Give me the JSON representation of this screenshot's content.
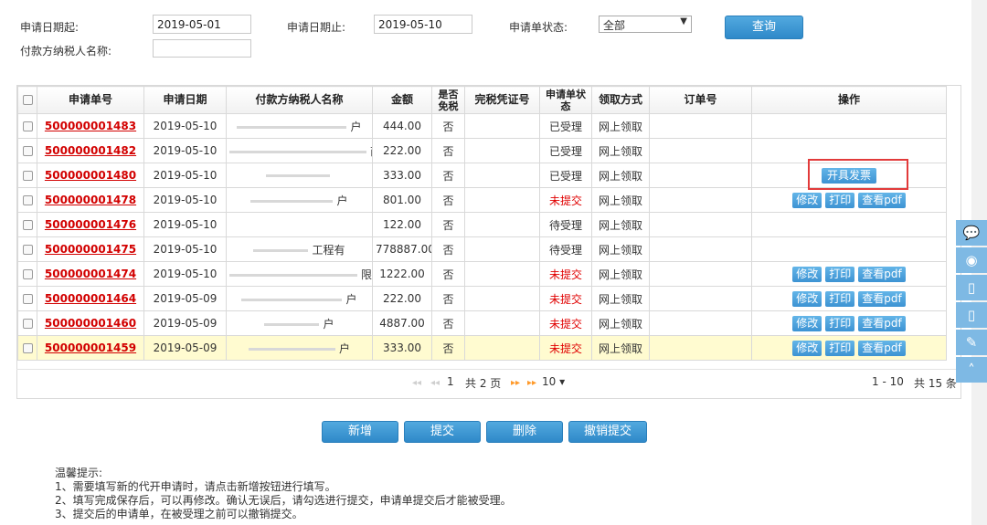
{
  "search": {
    "date_from_label": "申请日期起:",
    "date_from_value": "2019-05-01",
    "date_to_label": "申请日期止:",
    "date_to_value": "2019-05-10",
    "status_label": "申请单状态:",
    "status_value": "全部",
    "payer_label": "付款方纳税人名称:",
    "payer_value": "",
    "query_button": "查询"
  },
  "table": {
    "headers": [
      "申请单号",
      "申请日期",
      "付款方纳税人名称",
      "金额",
      "是否免税",
      "完税凭证号",
      "申请单状态",
      "领取方式",
      "订单号",
      "操作"
    ],
    "rows": [
      {
        "no": "500000001483",
        "date": "2019-05-10",
        "payer": "户",
        "amount": "444.00",
        "exempt": "否",
        "cert": "",
        "status": "已受理",
        "pickup": "网上领取",
        "order": "",
        "ops": []
      },
      {
        "no": "500000001482",
        "date": "2019-05-10",
        "payer": "商户",
        "amount": "222.00",
        "exempt": "否",
        "cert": "",
        "status": "已受理",
        "pickup": "网上领取",
        "order": "",
        "ops": []
      },
      {
        "no": "500000001480",
        "date": "2019-05-10",
        "payer": "",
        "amount": "333.00",
        "exempt": "否",
        "cert": "",
        "status": "已受理",
        "pickup": "网上领取",
        "order": "",
        "ops": [
          "开具发票"
        ]
      },
      {
        "no": "500000001478",
        "date": "2019-05-10",
        "payer": "户",
        "amount": "801.00",
        "exempt": "否",
        "cert": "",
        "status": "未提交",
        "pickup": "网上领取",
        "order": "",
        "ops": [
          "修改",
          "打印",
          "查看pdf"
        ]
      },
      {
        "no": "500000001476",
        "date": "2019-05-10",
        "payer": "",
        "amount": "122.00",
        "exempt": "否",
        "cert": "",
        "status": "待受理",
        "pickup": "网上领取",
        "order": "",
        "ops": []
      },
      {
        "no": "500000001475",
        "date": "2019-05-10",
        "payer": "工程有",
        "amount": "778887.00",
        "exempt": "否",
        "cert": "",
        "status": "待受理",
        "pickup": "网上领取",
        "order": "",
        "ops": []
      },
      {
        "no": "500000001474",
        "date": "2019-05-10",
        "payer": "限公司",
        "amount": "1222.00",
        "exempt": "否",
        "cert": "",
        "status": "未提交",
        "pickup": "网上领取",
        "order": "",
        "ops": [
          "修改",
          "打印",
          "查看pdf"
        ]
      },
      {
        "no": "500000001464",
        "date": "2019-05-09",
        "payer": "户",
        "amount": "222.00",
        "exempt": "否",
        "cert": "",
        "status": "未提交",
        "pickup": "网上领取",
        "order": "",
        "ops": [
          "修改",
          "打印",
          "查看pdf"
        ]
      },
      {
        "no": "500000001460",
        "date": "2019-05-09",
        "payer": "户",
        "amount": "4887.00",
        "exempt": "否",
        "cert": "",
        "status": "未提交",
        "pickup": "网上领取",
        "order": "",
        "ops": [
          "修改",
          "打印",
          "查看pdf"
        ]
      },
      {
        "no": "500000001459",
        "date": "2019-05-09",
        "payer": "户",
        "amount": "333.00",
        "exempt": "否",
        "cert": "",
        "status": "未提交",
        "pickup": "网上领取",
        "order": "",
        "ops": [
          "修改",
          "打印",
          "查看pdf"
        ]
      }
    ]
  },
  "pager": {
    "page_current": "1",
    "page_total": "共 2 页",
    "page_size": "10",
    "range": "1 - 10",
    "total": "共 15 条"
  },
  "actions": {
    "add": "新增",
    "submit": "提交",
    "delete": "删除",
    "withdraw": "撤销提交"
  },
  "tips": {
    "title": "温馨提示:",
    "lines": [
      "1、需要填写新的代开申请时，请点击新增按钮进行填写。",
      "2、填写完成保存后，可以再修改。确认无误后，请勾选进行提交，申请单提交后才能被受理。",
      "3、提交后的申请单，在被受理之前可以撤销提交。"
    ]
  },
  "colors": {
    "accent": "#3d93d3",
    "link_red": "#d20000",
    "highlight_row": "#fffbd0",
    "annotation_box": "#e23a3a"
  }
}
